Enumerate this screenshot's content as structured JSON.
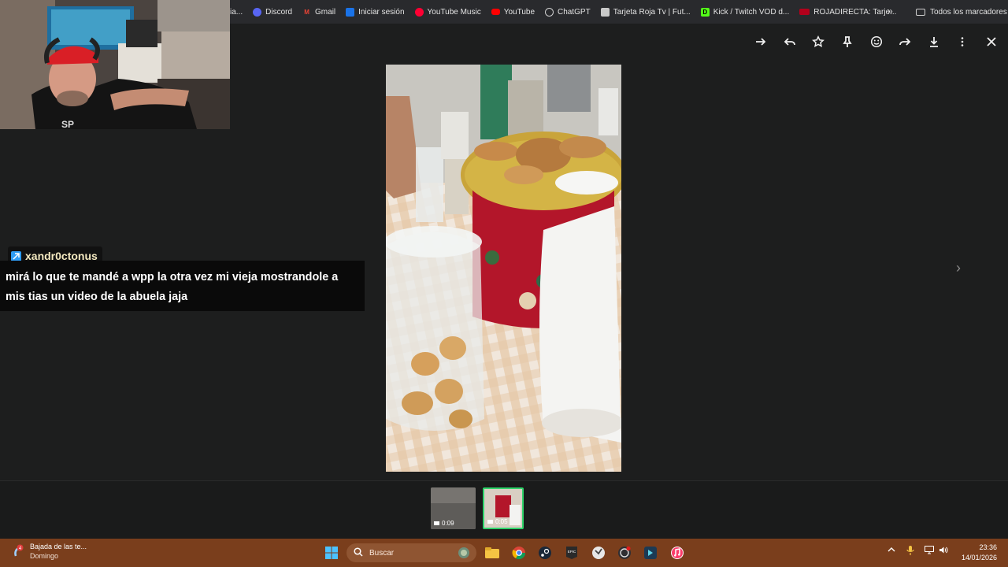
{
  "bookmarks": {
    "items": [
      {
        "label": "ia...",
        "color": "#3b3b3b"
      },
      {
        "label": "Discord",
        "color": "#5865f2"
      },
      {
        "label": "Gmail",
        "color": "#ea4335"
      },
      {
        "label": "Iniciar sesión",
        "color": "#1a73e8"
      },
      {
        "label": "YouTube Music",
        "color": "#ff0033"
      },
      {
        "label": "YouTube",
        "color": "#ff0000"
      },
      {
        "label": "ChatGPT",
        "color": "#9a9a9a"
      },
      {
        "label": "Tarjeta Roja Tv | Fut...",
        "color": "#c9c9c9"
      },
      {
        "label": "Kick / Twitch VOD d...",
        "color": "#53fc18"
      },
      {
        "label": "ROJADIRECTA: Tarje...",
        "color": "#b3001b"
      }
    ],
    "more": "»",
    "all_label": "Todos los marcadores"
  },
  "viewer": {
    "toolbar_icons": [
      "arrow-right-icon",
      "reply-icon",
      "star-icon",
      "pin-icon",
      "emoji-icon",
      "forward-icon",
      "download-icon",
      "more-vert-icon",
      "close-icon"
    ],
    "next": "›"
  },
  "chat": {
    "username": "xandr0ctonus",
    "message": "mirá lo que te mandé a wpp la otra vez mi vieja mostrandole a mis tias un video de la abuela jaja"
  },
  "thumbnails": [
    {
      "duration": "0:09",
      "selected": false
    },
    {
      "duration": "0:05",
      "selected": true
    }
  ],
  "taskbar": {
    "weather_title": "Bajada de las te...",
    "weather_sub": "Domingo",
    "weather_badge": "4",
    "search_placeholder": "Buscar",
    "time": "23:36",
    "date": "14/01/2026"
  }
}
